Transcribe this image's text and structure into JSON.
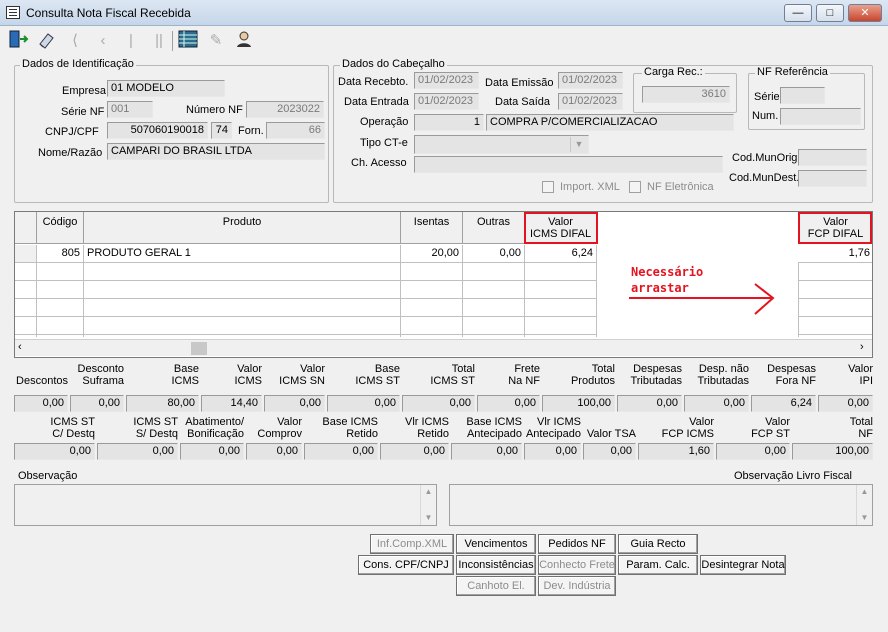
{
  "window": {
    "title": "Consulta Nota Fiscal Recebida",
    "minimize": "—",
    "maximize": "□",
    "close": "✕"
  },
  "toolbar": {
    "icons": [
      "exit-door-icon",
      "eraser-icon",
      "first-record-icon",
      "previous-record-icon",
      "next-record-icon",
      "last-record-icon",
      "grid-view-icon",
      "edit-disabled-icon",
      "user-query-icon"
    ]
  },
  "identificacao": {
    "title": "Dados de Identificação",
    "empresa_label": "Empresa",
    "empresa": "01 MODELO",
    "serie_label": "Série NF",
    "serie": "001",
    "numero_label": "Número NF",
    "numero": "2023022",
    "cnpj_label": "CNPJ/CPF",
    "cnpj": "507060190018",
    "cnpj_suffix": "74",
    "forn_label": "Forn.",
    "forn": "66",
    "nome_label": "Nome/Razão",
    "nome": "CAMPARI DO BRASIL LTDA"
  },
  "cabecalho": {
    "title": "Dados do Cabeçalho",
    "recebto_label": "Data Recebto.",
    "recebto": "01/02/2023",
    "emissao_label": "Data Emissão",
    "emissao": "01/02/2023",
    "entrada_label": "Data Entrada",
    "entrada": "01/02/2023",
    "saida_label": "Data Saída",
    "saida": "01/02/2023",
    "operacao_label": "Operação",
    "operacao_cod": "1",
    "operacao_desc": "COMPRA P/COMERCIALIZACAO",
    "tipocte_label": "Tipo CT-e",
    "tipocte": "",
    "chacesso_label": "Ch. Acesso",
    "chacesso": "",
    "carga_title": "Carga Rec.:",
    "carga": "3610",
    "nfref_title": "NF Referência",
    "serie_label": "Série",
    "num_label": "Num.",
    "codmunorig_label": "Cod.MunOrig.",
    "codmundest_label": "Cod.MunDest.",
    "import_xml": "Import. XML",
    "nf_eletronica": "NF Eletrônica"
  },
  "grid": {
    "headers": {
      "codigo": "Código",
      "produto": "Produto",
      "isentas": "Isentas",
      "outras": "Outras",
      "icms_difal_1": "Valor",
      "icms_difal_2": "ICMS DIFAL",
      "fcp_difal_1": "Valor",
      "fcp_difal_2": "FCP DIFAL"
    },
    "row": {
      "codigo": "805",
      "produto": "PRODUTO GERAL 1",
      "isentas": "20,00",
      "outras": "0,00",
      "icms_difal": "6,24",
      "fcp_difal": "1,76"
    },
    "annotation_line1": "Necessário",
    "annotation_line2": "arrastar",
    "annotation_color": "#e3141f"
  },
  "totals1": [
    {
      "label": "Descontos",
      "value": "0,00"
    },
    {
      "label": "Desconto\nSuframa",
      "value": "0,00"
    },
    {
      "label": "Base\nICMS",
      "value": "80,00"
    },
    {
      "label": "Valor\nICMS",
      "value": "14,40"
    },
    {
      "label": "Valor\nICMS SN",
      "value": "0,00"
    },
    {
      "label": "Base\nICMS ST",
      "value": "0,00"
    },
    {
      "label": "Total\nICMS ST",
      "value": "0,00"
    },
    {
      "label": "Frete\nNa NF",
      "value": "0,00"
    },
    {
      "label": "Total\nProdutos",
      "value": "100,00"
    },
    {
      "label": "Despesas\nTributadas",
      "value": "0,00"
    },
    {
      "label": "Desp. não\nTributadas",
      "value": "0,00"
    },
    {
      "label": "Despesas\nFora NF",
      "value": "6,24"
    },
    {
      "label": "Valor\nIPI",
      "value": "0,00"
    }
  ],
  "totals2": [
    {
      "label": "ICMS ST\nC/ Destq",
      "value": "0,00"
    },
    {
      "label": "ICMS ST\nS/ Destq",
      "value": "0,00"
    },
    {
      "label": "Abatimento/\nBonificação",
      "value": "0,00"
    },
    {
      "label": "Valor\nComprov",
      "value": "0,00"
    },
    {
      "label": "Base ICMS\nRetido",
      "value": "0,00"
    },
    {
      "label": "Vlr ICMS\nRetido",
      "value": "0,00"
    },
    {
      "label": "Base ICMS\nAntecipado",
      "value": "0,00"
    },
    {
      "label": "Vlr ICMS\nAntecipado",
      "value": "0,00"
    },
    {
      "label": "Valor TSA",
      "value": "0,00"
    },
    {
      "label": "Valor\nFCP ICMS",
      "value": "1,60"
    },
    {
      "label": "Valor\nFCP ST",
      "value": "0,00"
    },
    {
      "label": "Total\nNF",
      "value": "100,00"
    }
  ],
  "observacao": {
    "label": "Observação",
    "livro_label": "Observação Livro Fiscal"
  },
  "buttons": {
    "inf_comp_xml": "Inf.Comp.XML",
    "vencimentos": "Vencimentos",
    "pedidos_nf": "Pedidos NF",
    "guia_recto": "Guia Recto",
    "cons_cpf_cnpj": "Cons. CPF/CNPJ",
    "inconsistencias": "Inconsistências",
    "conhecto_frete": "Conhecto Frete",
    "param_calc": "Param. Calc.",
    "desintegrar_nota": "Desintegrar Nota",
    "canhoto_el": "Canhoto El.",
    "dev_industria": "Dev. Indústria"
  }
}
